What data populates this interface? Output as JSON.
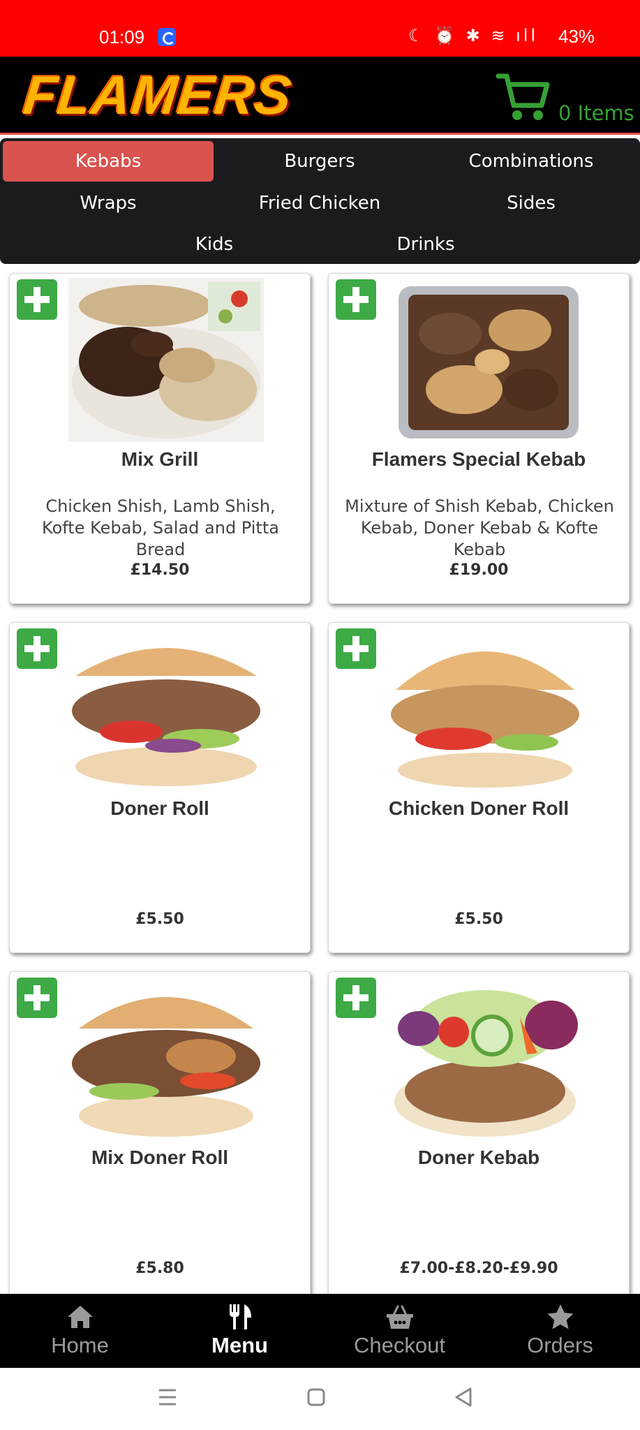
{
  "status_bar": {
    "time": "01:09",
    "icons": "☾ ⏰ ✱ ≋ ıll",
    "battery": "43%"
  },
  "header": {
    "logo_text": "FLAMERS",
    "cart_count": "0 Items",
    "cart_icon": "cart-icon",
    "cart_color": "#35a135"
  },
  "categories": [
    {
      "label": "Kebabs",
      "active": true
    },
    {
      "label": "Burgers"
    },
    {
      "label": "Combinations"
    },
    {
      "label": "Wraps"
    },
    {
      "label": "Fried Chicken"
    },
    {
      "label": "Sides"
    },
    {
      "label": "Kids"
    },
    {
      "label": "Drinks"
    }
  ],
  "products": [
    {
      "name": "Mix Grill",
      "description": "Chicken Shish, Lamb Shish, Kofte Kebab, Salad and Pitta Bread",
      "price": "£14.50"
    },
    {
      "name": "Flamers Special Kebab",
      "description": "Mixture of Shish Kebab, Chicken Kebab, Doner Kebab & Kofte Kebab",
      "price": "£19.00"
    },
    {
      "name": "Doner Roll",
      "description": "",
      "price": "£5.50"
    },
    {
      "name": "Chicken Doner Roll",
      "description": "",
      "price": "£5.50"
    },
    {
      "name": "Mix Doner Roll",
      "description": "",
      "price": "£5.80"
    },
    {
      "name": "Doner Kebab",
      "description": "",
      "price": "£7.00-£8.20-£9.90"
    }
  ],
  "bottom_nav": [
    {
      "label": "Home",
      "icon": "home-icon"
    },
    {
      "label": "Menu",
      "icon": "cutlery-icon",
      "active": true
    },
    {
      "label": "Checkout",
      "icon": "basket-icon"
    },
    {
      "label": "Orders",
      "icon": "star-icon"
    }
  ],
  "colors": {
    "status_bar": "#ff0000",
    "accent": "#d9534f",
    "add_button": "#3daa46"
  }
}
